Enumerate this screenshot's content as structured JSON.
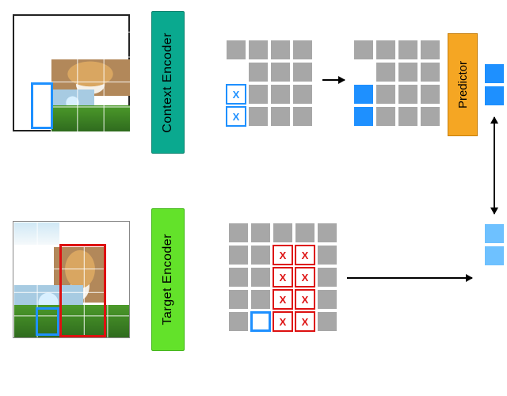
{
  "diagram": {
    "context_encoder_label": "Context Encoder",
    "target_encoder_label": "Target Encoder",
    "predictor_label": "Predictor",
    "mask_token_glyph": "X",
    "colors": {
      "context_encoder": "#0aa98f",
      "target_encoder": "#63e22a",
      "predictor": "#f5a623",
      "highlight_blue": "#1e90ff",
      "highlight_red": "#d11",
      "token_grey": "#a7a7a7",
      "token_light_blue": "#6ec1ff"
    },
    "top_row": {
      "image": {
        "description": "cropped photo region (dog in water with flowers) inside a larger blank frame",
        "visible_grid": {
          "rows": 4,
          "cols": 3
        },
        "blue_box": {
          "row_start": 2,
          "row_span": 2,
          "col_start": -1,
          "col_span": 1,
          "note": "1-col wide, overlaps left edge of visible crop"
        }
      },
      "token_grid_in": {
        "rows": 4,
        "cols": 3,
        "extra_left_column_top": true,
        "blue_outline_cells": [
          [
            2,
            -1
          ],
          [
            3,
            -1
          ]
        ],
        "x_cells": [
          [
            2,
            -1
          ],
          [
            3,
            -1
          ]
        ]
      },
      "token_grid_mid": {
        "rows": 4,
        "cols": 3,
        "extra_left_column_top": true,
        "blue_filled_cells": [
          [
            2,
            -1
          ],
          [
            3,
            -1
          ]
        ]
      },
      "predictor_output_tokens": 2,
      "loss_compare_tokens": 2
    },
    "bottom_row": {
      "image": {
        "description": "full photo (dog in water with flowers) with 5x5 grid",
        "grid": {
          "rows": 5,
          "cols": 5
        },
        "blue_box": {
          "row": 4,
          "col": 1,
          "row_span": 1,
          "col_span": 1
        },
        "red_box": {
          "row_start": 1,
          "row_span": 4,
          "col_start": 2,
          "col_span": 2
        }
      },
      "token_grid": {
        "rows": 5,
        "cols": 5,
        "red_outline_cells": [
          [
            1,
            2
          ],
          [
            1,
            3
          ],
          [
            2,
            2
          ],
          [
            2,
            3
          ],
          [
            3,
            2
          ],
          [
            3,
            3
          ],
          [
            4,
            2
          ],
          [
            4,
            3
          ]
        ],
        "x_cells": [
          [
            1,
            2
          ],
          [
            1,
            3
          ],
          [
            2,
            2
          ],
          [
            2,
            3
          ],
          [
            3,
            2
          ],
          [
            3,
            3
          ],
          [
            4,
            2
          ],
          [
            4,
            3
          ]
        ],
        "blue_outline_cells": [
          [
            4,
            1
          ]
        ]
      },
      "output_tokens": 2
    }
  }
}
